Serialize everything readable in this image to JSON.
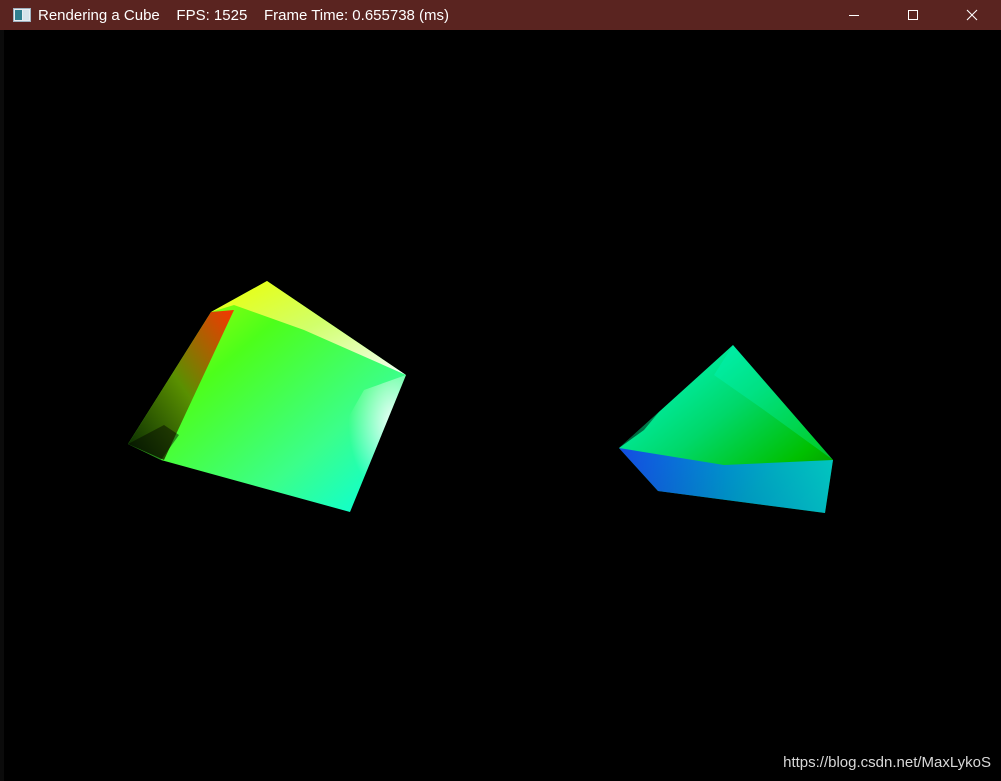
{
  "window": {
    "title": "Rendering a Cube    FPS: 1525    Frame Time: 0.655738 (ms)",
    "titlebar_color": "#5a2420",
    "background_color": "#000000",
    "controls": {
      "minimize_icon": "minimize-icon",
      "maximize_icon": "maximize-icon",
      "close_icon": "close-icon"
    }
  },
  "scene": {
    "objects": [
      {
        "name": "cube-left",
        "colors": [
          "#ff2a00",
          "#f2ff00",
          "#52ff1a",
          "#ffffff",
          "#00ffe6",
          "#003300"
        ]
      },
      {
        "name": "cube-right",
        "colors": [
          "#00ffd5",
          "#00c800",
          "#1a1aff",
          "#00d0ff",
          "#000000"
        ]
      }
    ]
  },
  "watermark": "https://blog.csdn.net/MaxLykoS"
}
